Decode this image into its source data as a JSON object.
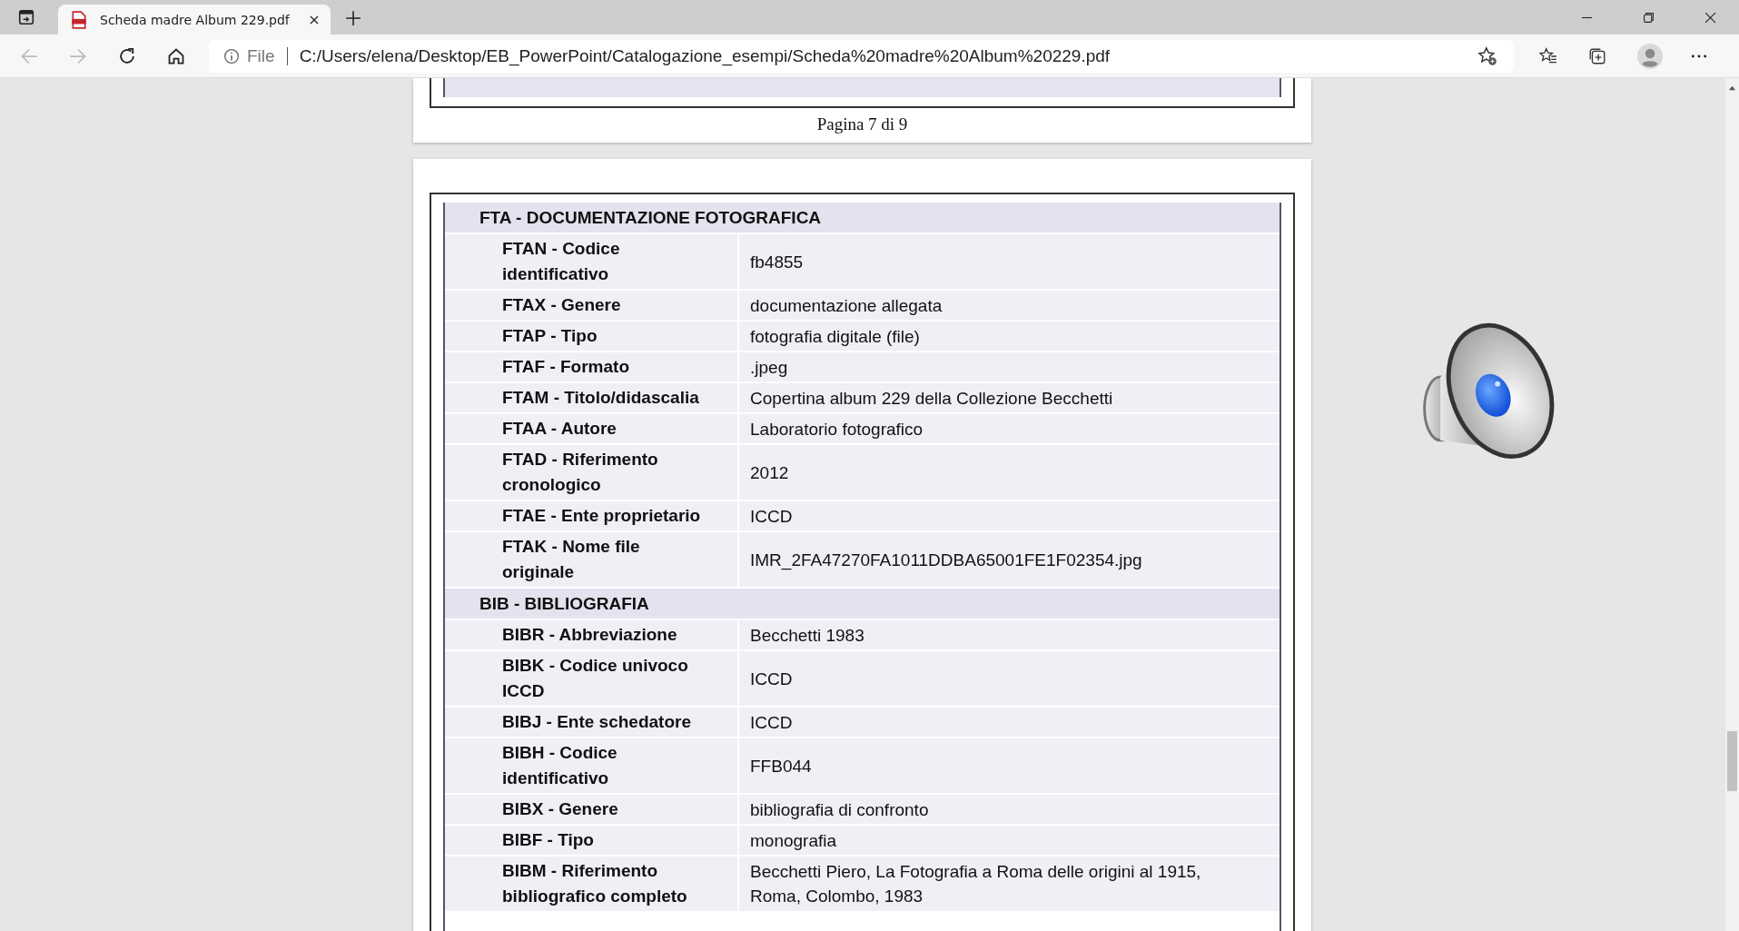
{
  "tabs": [
    {
      "title": "Scheda madre Album 229.pdf",
      "selected": true
    }
  ],
  "address_bar": {
    "scheme_label": "File",
    "url": "C:/Users/elena/Desktop/EB_PowerPoint/Catalogazione_esempi/Scheda%20madre%20Album%20229.pdf"
  },
  "previous_page": {
    "footer": "Pagina 7 di 9"
  },
  "table": {
    "sections": [
      {
        "title": "FTA - DOCUMENTAZIONE FOTOGRAFICA",
        "rows": [
          {
            "label": "FTAN - Codice identificativo",
            "value": "fb4855"
          },
          {
            "label": "FTAX - Genere",
            "value": "documentazione allegata"
          },
          {
            "label": "FTAP - Tipo",
            "value": "fotografia digitale (file)"
          },
          {
            "label": "FTAF - Formato",
            "value": ".jpeg"
          },
          {
            "label": "FTAM - Titolo/didascalia",
            "value": "Copertina album 229 della Collezione Becchetti"
          },
          {
            "label": "FTAA - Autore",
            "value": "Laboratorio fotografico"
          },
          {
            "label": "FTAD - Riferimento cronologico",
            "value": "2012"
          },
          {
            "label": "FTAE - Ente proprietario",
            "value": "ICCD"
          },
          {
            "label": "FTAK - Nome file originale",
            "value": "IMR_2FA47270FA1011DDBA65001FE1F02354.jpg"
          }
        ]
      },
      {
        "title": "BIB - BIBLIOGRAFIA",
        "rows": [
          {
            "label": "BIBR - Abbreviazione",
            "value": "Becchetti 1983"
          },
          {
            "label": "BIBK - Codice univoco ICCD",
            "value": "ICCD"
          },
          {
            "label": "BIBJ - Ente schedatore",
            "value": "ICCD"
          },
          {
            "label": "BIBH - Codice identificativo",
            "value": "FFB044"
          },
          {
            "label": "BIBX - Genere",
            "value": "bibliografia di confronto"
          },
          {
            "label": "BIBF - Tipo",
            "value": "monografia"
          },
          {
            "label": "BIBM - Riferimento bibliografico completo",
            "value": "Becchetti Piero, La Fotografia a Roma delle origini al 1915, Roma, Colombo, 1983"
          }
        ]
      }
    ]
  }
}
